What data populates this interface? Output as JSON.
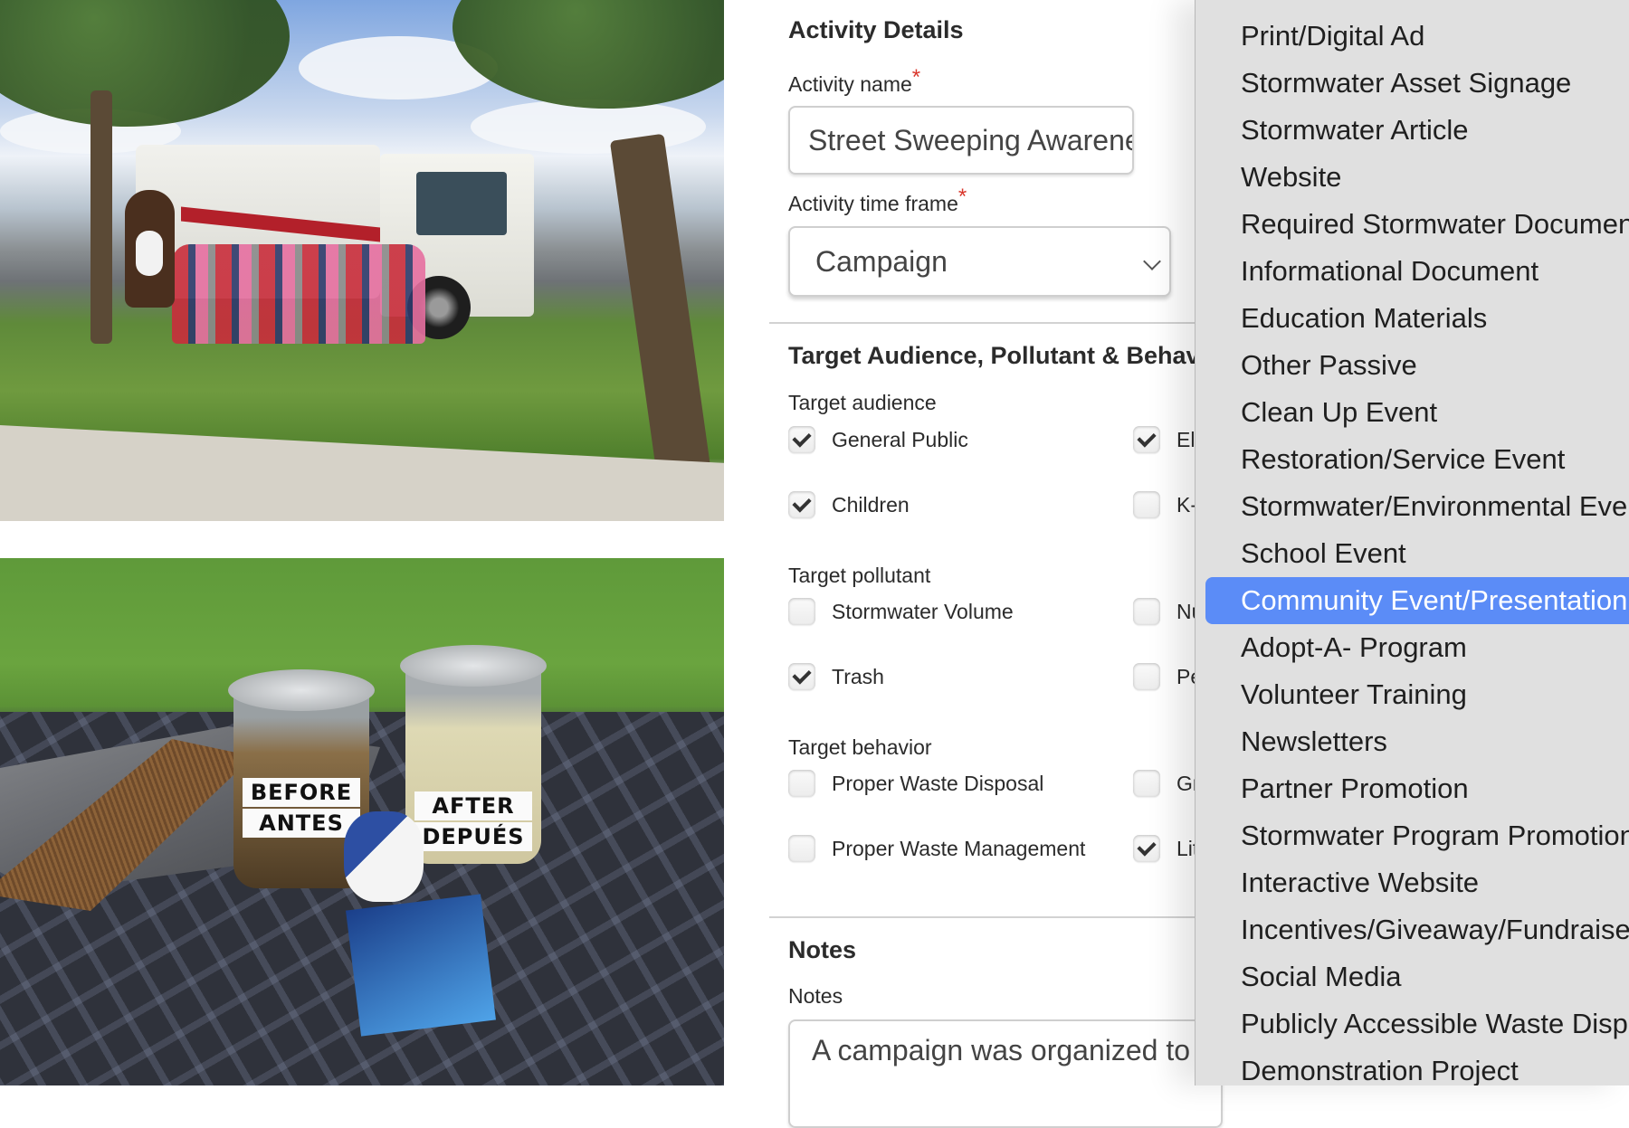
{
  "photos": {
    "top": {
      "description": "Street sweeper truck with mascot and children on grass"
    },
    "bottom": {
      "description": "Before/After jars with broom, dustpan, stress ball and card",
      "jar_before_labels": [
        "BEFORE",
        "ANTES"
      ],
      "jar_after_labels": [
        "AFTER",
        "DEPUÉS"
      ]
    }
  },
  "form": {
    "activity_details": {
      "title": "Activity Details",
      "name_label": "Activity name",
      "name_value": "Street Sweeping Awareness",
      "timeframe_label": "Activity time frame",
      "timeframe_value": "Campaign",
      "required_mark": "*"
    },
    "target": {
      "title": "Target Audience, Pollutant & Behavior",
      "audience_label": "Target audience",
      "audience": [
        {
          "label": "General Public",
          "checked": true
        },
        {
          "label": "El",
          "checked": true
        },
        {
          "label": "Children",
          "checked": true
        },
        {
          "label": "K-",
          "checked": false
        }
      ],
      "pollutant_label": "Target pollutant",
      "pollutant": [
        {
          "label": "Stormwater Volume",
          "checked": false
        },
        {
          "label": "Nu",
          "checked": false
        },
        {
          "label": "Trash",
          "checked": true
        },
        {
          "label": "Pe",
          "checked": false
        }
      ],
      "behavior_label": "Target behavior",
      "behavior": [
        {
          "label": "Proper Waste Disposal",
          "checked": false
        },
        {
          "label": "Gr",
          "checked": false
        },
        {
          "label": "Proper Waste Management",
          "checked": false
        },
        {
          "label": "Lit",
          "checked": true
        }
      ]
    },
    "notes": {
      "title": "Notes",
      "label": "Notes",
      "value": "A campaign was organized to d"
    }
  },
  "dropdown": {
    "selected_index": 12,
    "colors": {
      "background": "#e0e0e0",
      "highlight": "#5b8cf7"
    },
    "options": [
      "Print/Digital Ad",
      "Stormwater Asset Signage",
      "Stormwater Article",
      "Website",
      "Required Stormwater Document",
      "Informational Document",
      "Education Materials",
      "Other Passive",
      "Clean Up Event",
      "Restoration/Service Event",
      "Stormwater/Environmental Event",
      "School Event",
      "Community Event/Presentation",
      "Adopt-A- Program",
      "Volunteer Training",
      "Newsletters",
      "Partner Promotion",
      "Stormwater Program Promotion",
      "Interactive Website",
      "Incentives/Giveaway/Fundraiser",
      "Social Media",
      "Publicly Accessible Waste Disposal",
      "Demonstration Project"
    ]
  }
}
